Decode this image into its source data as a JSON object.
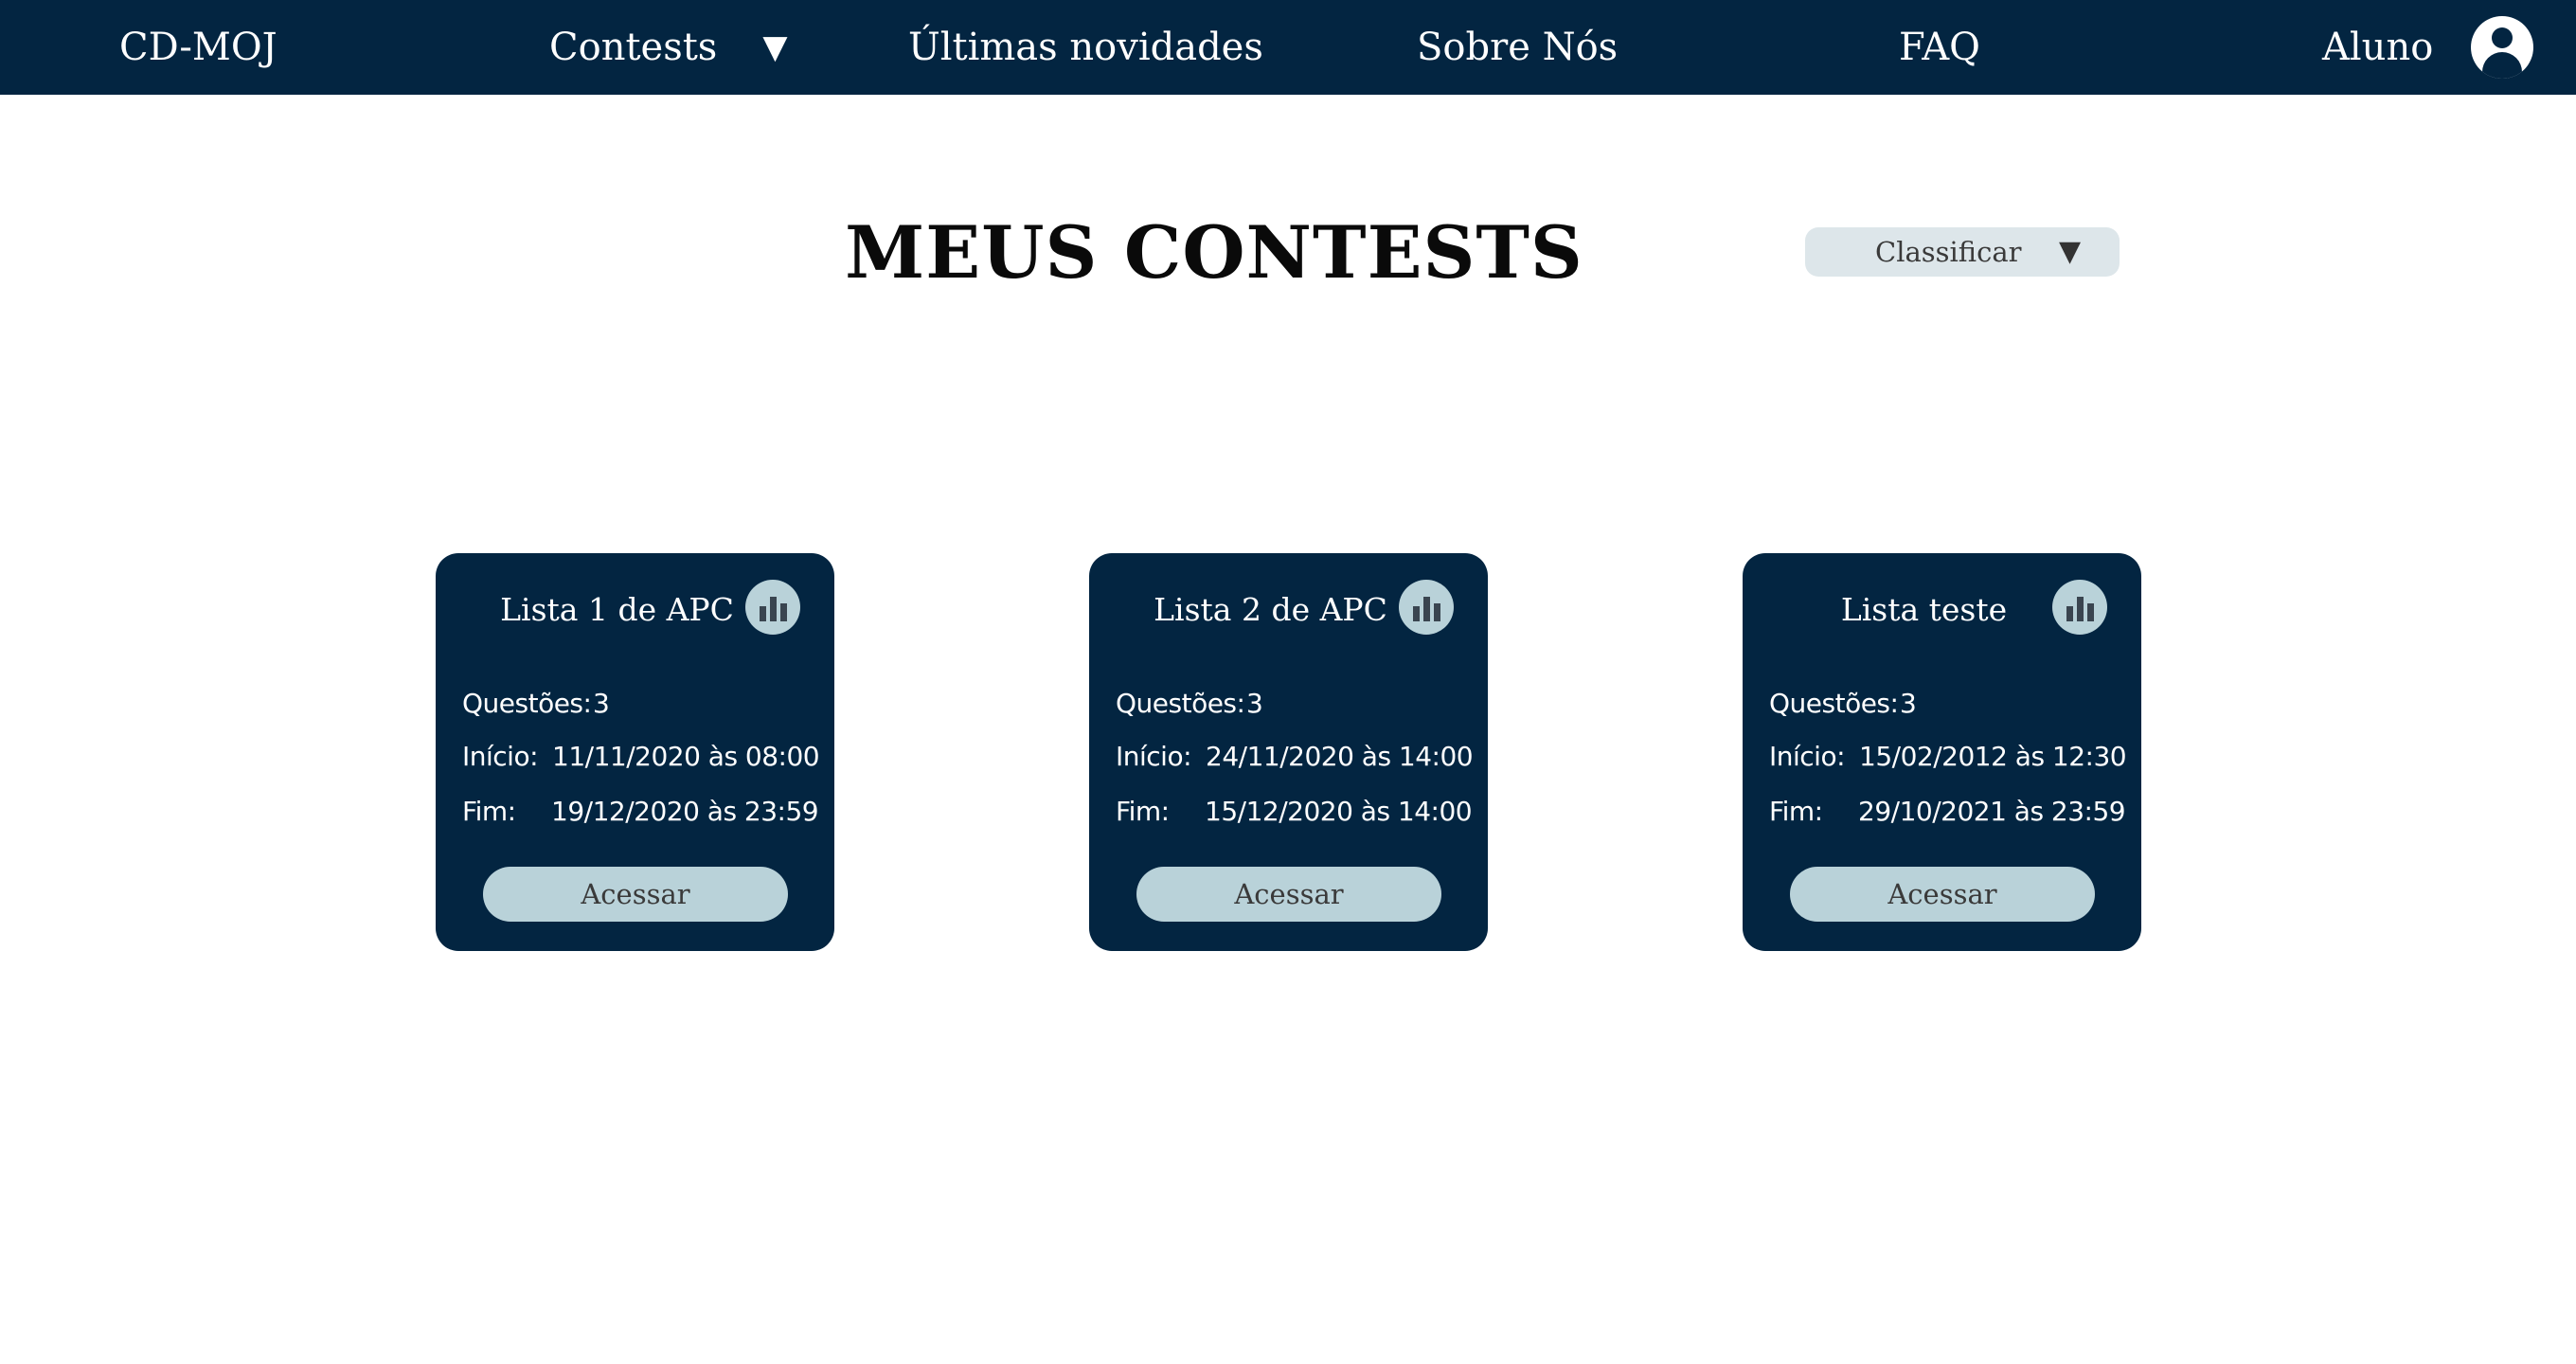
{
  "nav": {
    "brand": "CD-MOJ",
    "contests": "Contests",
    "contests_caret": "▼",
    "news": "Últimas novidades",
    "about": "Sobre Nós",
    "faq": "FAQ",
    "user": "Aluno"
  },
  "page": {
    "title": "MEUS CONTESTS"
  },
  "sort": {
    "label": "Classificar",
    "caret": "▼"
  },
  "cards": [
    {
      "title": "Lista 1 de APC",
      "questions_label": "Questões:",
      "questions": "3",
      "start_label": "Início:",
      "start": "11/11/2020 às 08:00",
      "end_label": "Fim:",
      "end": "19/12/2020 às 23:59",
      "button": "Acessar"
    },
    {
      "title": "Lista 2 de APC",
      "questions_label": "Questões:",
      "questions": "3",
      "start_label": "Início:",
      "start": "24/11/2020 às 14:00",
      "end_label": "Fim:",
      "end": "15/12/2020 às 14:00",
      "button": "Acessar"
    },
    {
      "title": "Lista teste",
      "questions_label": "Questões:",
      "questions": "3",
      "start_label": "Início:",
      "start": "15/02/2012 às 12:30",
      "end_label": "Fim:",
      "end": "29/10/2021 às 23:59",
      "button": "Acessar"
    }
  ],
  "icons": {
    "stats": "bar-chart-icon",
    "user": "user-avatar-icon"
  },
  "colors": {
    "navy": "#032541",
    "light_blue": "#b9d2d9",
    "dropdown_bg": "#dde6ea"
  }
}
